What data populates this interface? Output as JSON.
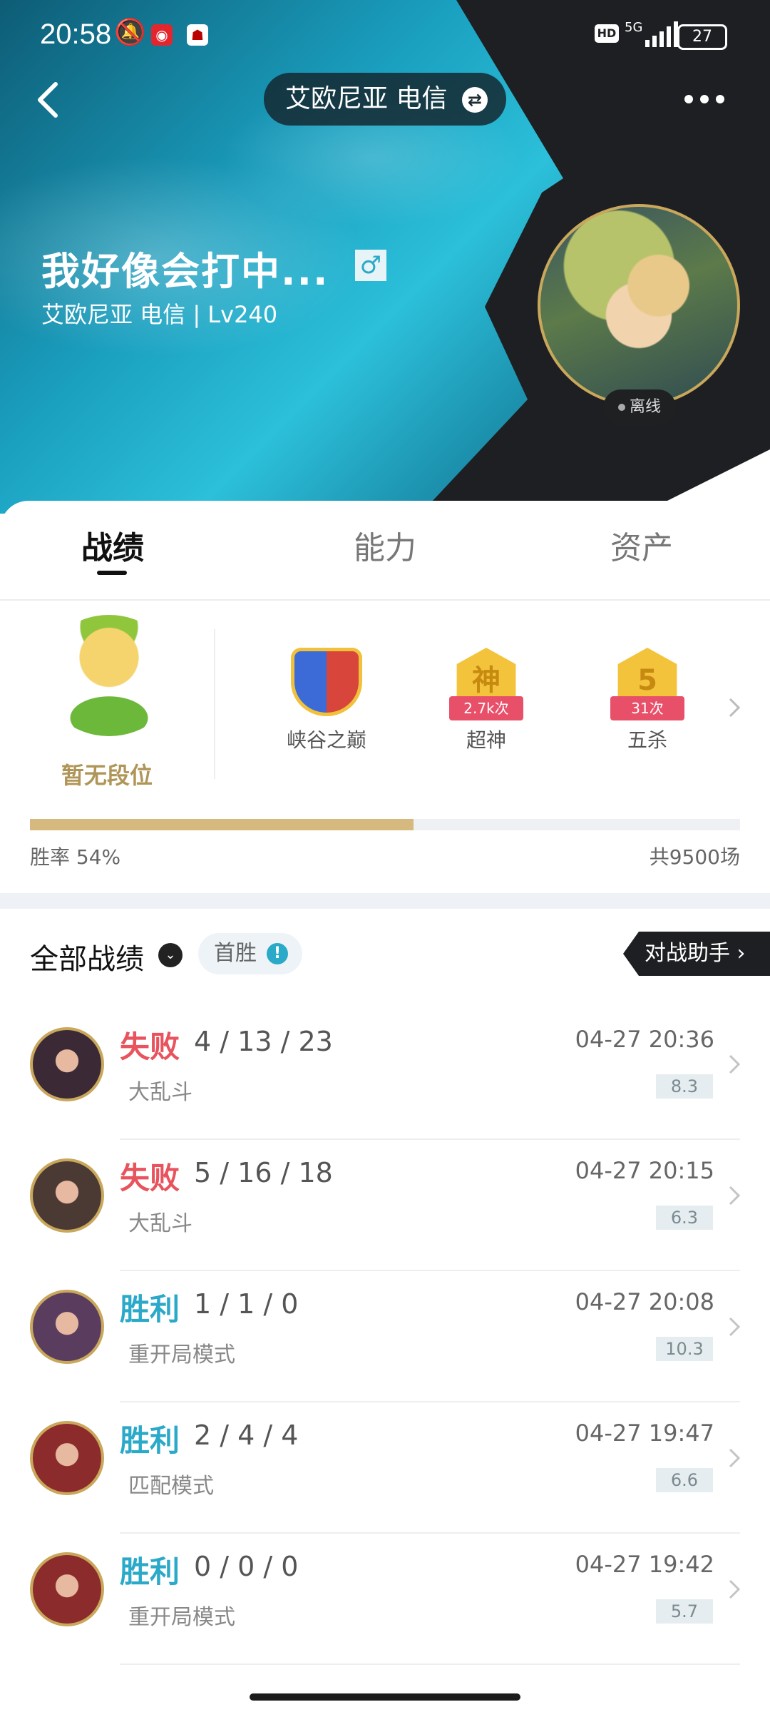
{
  "status_bar": {
    "time": "20:58",
    "battery": "27",
    "network": "5G"
  },
  "header": {
    "server_pill": "艾欧尼亚 电信",
    "player_name": "我好像会打中...",
    "gender_symbol": "♂",
    "player_sub": "艾欧尼亚 电信 | Lv240",
    "status": "离线"
  },
  "tabs": [
    "战绩",
    "能力",
    "资产"
  ],
  "rank": {
    "label": "暂无段位"
  },
  "honors": [
    {
      "label": "峡谷之巅",
      "ribbon": ""
    },
    {
      "label": "超神",
      "ribbon": "2.7k次",
      "glyph": "神"
    },
    {
      "label": "五杀",
      "ribbon": "31次",
      "glyph": "5"
    }
  ],
  "stats": {
    "winrate_label": "胜率  54%",
    "winrate": 0.54,
    "total": "共9500场"
  },
  "match_section": {
    "title": "全部战绩",
    "first_win": "首胜",
    "assistant": "对战助手 ›"
  },
  "matches": [
    {
      "result": "失败",
      "outcome": "lose",
      "kda": "4 / 13 / 23",
      "mode": "大乱斗",
      "time": "04-27 20:36",
      "score": "8.3",
      "hero_color": "#3b2a35"
    },
    {
      "result": "失败",
      "outcome": "lose",
      "kda": "5 / 16 / 18",
      "mode": "大乱斗",
      "time": "04-27 20:15",
      "score": "6.3",
      "hero_color": "#4a3a33"
    },
    {
      "result": "胜利",
      "outcome": "win",
      "kda": "1 / 1 / 0",
      "mode": "重开局模式",
      "time": "04-27 20:08",
      "score": "10.3",
      "hero_color": "#5a3c5e"
    },
    {
      "result": "胜利",
      "outcome": "win",
      "kda": "2 / 4 / 4",
      "mode": "匹配模式",
      "time": "04-27 19:47",
      "score": "6.6",
      "hero_color": "#8c2b2b"
    },
    {
      "result": "胜利",
      "outcome": "win",
      "kda": "0 / 0 / 0",
      "mode": "重开局模式",
      "time": "04-27 19:42",
      "score": "5.7",
      "hero_color": "#8c2b2b"
    }
  ],
  "colors": {
    "win": "#2aa9c9",
    "lose": "#e8535d",
    "gold": "#c9a75b",
    "winrate_fill": "#d5b97f"
  }
}
